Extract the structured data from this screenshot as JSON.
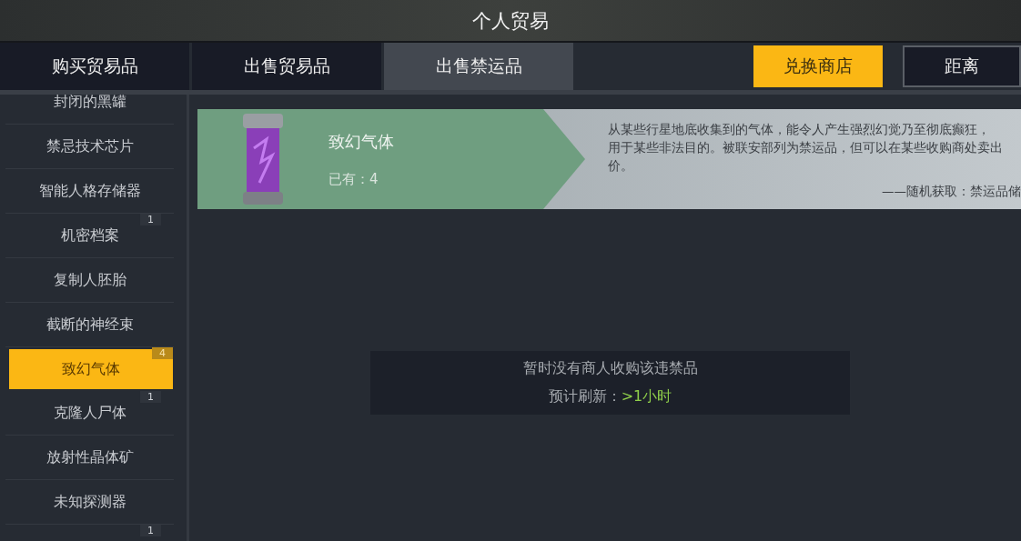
{
  "window": {
    "title": "个人贸易"
  },
  "tabs": [
    {
      "label": "购买贸易品",
      "selected": false
    },
    {
      "label": "出售贸易品",
      "selected": false
    },
    {
      "label": "出售禁运品",
      "selected": true
    }
  ],
  "header_buttons": [
    {
      "label": "兑换商店",
      "kind": "primary"
    },
    {
      "label": "距离",
      "kind": "outline"
    }
  ],
  "sidebar": {
    "items": [
      {
        "label": "封闭的黑罐",
        "selected": false
      },
      {
        "label": "禁忌技术芯片",
        "selected": false
      },
      {
        "label": "智能人格存储器",
        "selected": false
      },
      {
        "label": "机密档案",
        "selected": false,
        "badge": "1"
      },
      {
        "label": "复制人胚胎",
        "selected": false
      },
      {
        "label": "截断的神经束",
        "selected": false
      },
      {
        "label": "致幻气体",
        "selected": true,
        "badge": "4"
      },
      {
        "label": "克隆人尸体",
        "selected": false,
        "badge": "1"
      },
      {
        "label": "放射性晶体矿",
        "selected": false
      },
      {
        "label": "未知探测器",
        "selected": false
      },
      {
        "badge": "1"
      }
    ]
  },
  "item": {
    "name": "致幻气体",
    "owned": "已有：4",
    "description": [
      "从某些行星地底收集到的气体，能令人产生强烈幻觉乃至彻底癫狂，",
      "用于某些非法目的。被联安部列为禁运品，但可以在某些收购商处卖出",
      "价。"
    ],
    "source": "——随机获取：禁运品储"
  },
  "notice": {
    "message": "暂时没有商人收购该违禁品",
    "refresh_label": "预计刷新：",
    "refresh_value": ">1小时"
  }
}
